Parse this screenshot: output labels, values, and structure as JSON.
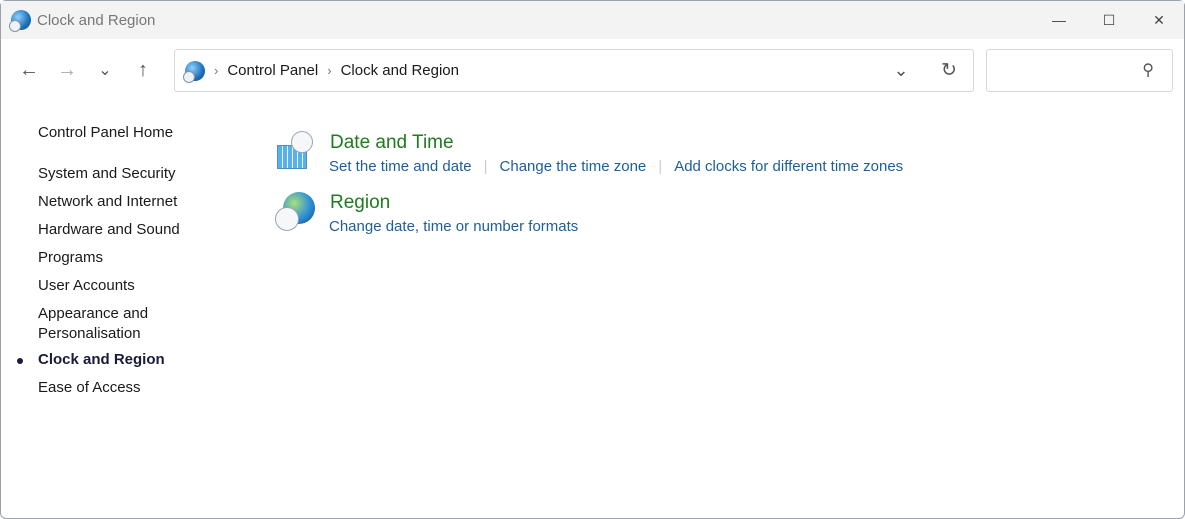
{
  "window": {
    "title": "Clock and Region",
    "minimize": "—",
    "maximize": "☐",
    "close": "✕"
  },
  "nav": {
    "back": "←",
    "forward": "→",
    "recent": "⌄",
    "up": "↑"
  },
  "address": {
    "separator": "›",
    "crumbs": [
      "Control Panel",
      "Clock and Region"
    ],
    "dropdown": "⌄",
    "refresh": "↻"
  },
  "search": {
    "icon": "⚲",
    "placeholder": ""
  },
  "sidebar": {
    "home": "Control Panel Home",
    "items": [
      "System and Security",
      "Network and Internet",
      "Hardware and Sound",
      "Programs",
      "User Accounts",
      "Appearance and Personalisation",
      "Clock and Region",
      "Ease of Access"
    ],
    "active": "Clock and Region"
  },
  "sections": [
    {
      "title": "Date and Time",
      "links": [
        "Set the time and date",
        "Change the time zone",
        "Add clocks for different time zones"
      ]
    },
    {
      "title": "Region",
      "links": [
        "Change date, time or number formats"
      ]
    }
  ],
  "colors": {
    "heading": "#1e7b1e",
    "link": "#1d5e9c"
  }
}
